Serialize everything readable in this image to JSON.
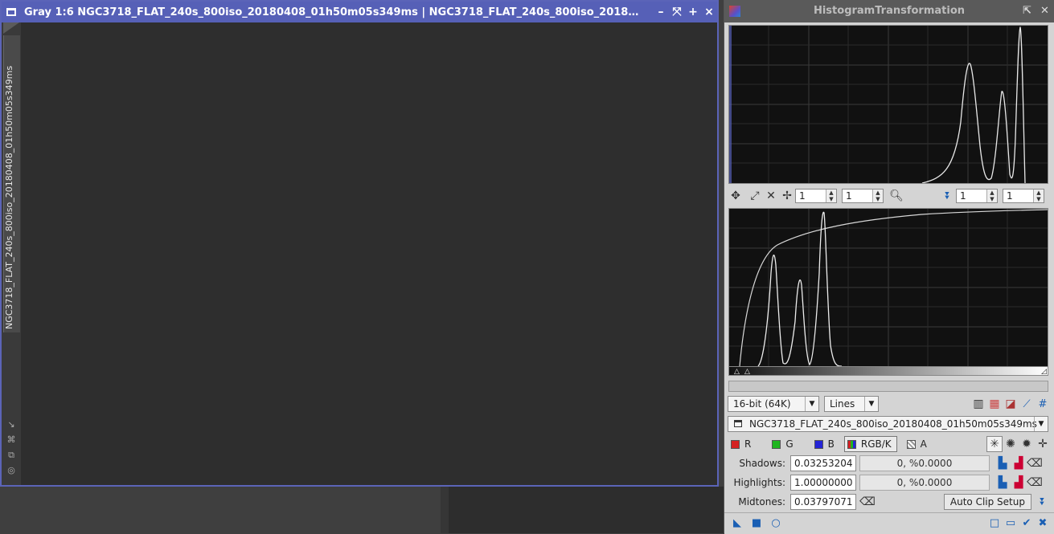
{
  "image_window": {
    "title": "Gray 1:6 NGC3718_FLAT_240s_800iso_20180408_01h50m05s349ms | NGC3718_FLAT_240s_800iso_2018…",
    "side_tab_label": "NGC3718_FLAT_240s_800iso_20180408_01h50m05s349ms",
    "buttons": [
      "–",
      "⤧",
      "+",
      "×"
    ]
  },
  "histogram_panel": {
    "title": "HistogramTransformation",
    "zoom": {
      "h1": "1",
      "v1": "1",
      "h2": "1",
      "v2": "1"
    },
    "resolution": "16-bit (64K)",
    "graph_style": "Lines",
    "view": "NGC3718_FLAT_240s_800iso_20180408_01h50m05s349ms",
    "channels": {
      "r": "R",
      "g": "G",
      "b": "B",
      "rgbk": "RGB/K",
      "a": "A"
    },
    "shadows": {
      "label": "Shadows:",
      "value": "0.03253204",
      "clip": "0, %0.0000"
    },
    "highlights": {
      "label": "Highlights:",
      "value": "1.00000000",
      "clip": "0, %0.0000"
    },
    "midtones": {
      "label": "Midtones:",
      "value": "0.03797071"
    },
    "auto_clip_label": "Auto Clip Setup",
    "colors": {
      "accent": "#5660b7",
      "r": "#d42222",
      "g": "#1fb51f",
      "b": "#2424d6"
    }
  }
}
